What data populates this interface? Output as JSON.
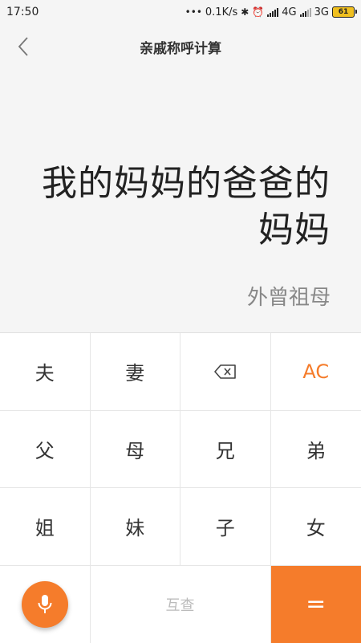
{
  "status_bar": {
    "time": "17:50",
    "net_speed": "0.1K/s",
    "net_type_1": "4G",
    "net_type_2": "3G",
    "battery": "61"
  },
  "header": {
    "title": "亲戚称呼计算"
  },
  "display": {
    "expression": "我的妈妈的爸爸的妈妈",
    "result": "外曾祖母"
  },
  "keypad": {
    "row1": [
      "夫",
      "妻",
      "backspace-icon",
      "AC"
    ],
    "row2": [
      "父",
      "母",
      "兄",
      "弟"
    ],
    "row3": [
      "姐",
      "妹",
      "子",
      "女"
    ],
    "mutual_label": "互查",
    "equals_label": "="
  },
  "colors": {
    "accent": "#f57c2b",
    "background": "#f5f5f5",
    "keypad_bg": "#ffffff"
  }
}
